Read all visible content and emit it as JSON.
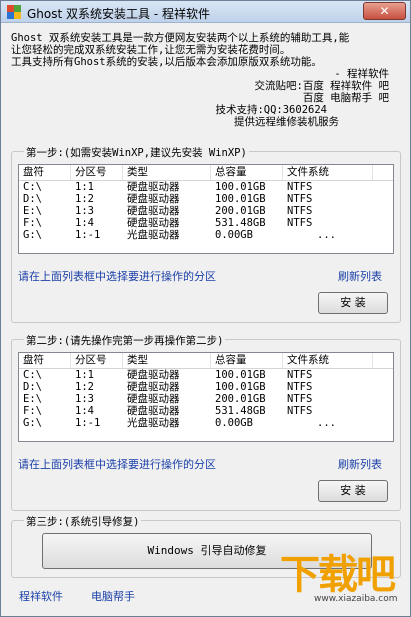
{
  "window": {
    "title": "Ghost 双系统安装工具 - 程祥软件",
    "close_label": "✕"
  },
  "intro": {
    "lines": [
      "Ghost 双系统安装工具是一款方便网友安装两个以上系统的辅助工具,能",
      "让您轻松的完成双系统安装工作,让您无需为安装花费时间。",
      "工具支持所有Ghost系统的安装,以后版本会添加原版双系统功能。"
    ],
    "signature": "- 程祥软件",
    "forum": "交流贴吧:百度 程祥软件 吧",
    "forum2": "百度 电脑帮手 吧",
    "support": "技术支持:QQ:3602624",
    "service": "提供远程维修装机服务"
  },
  "table_headers": [
    "盘符",
    "分区号",
    "类型",
    "总容量",
    "文件系统"
  ],
  "step1": {
    "label": "第一步:(如需安装WinXP,建议先安装 WinXP)",
    "rows": [
      [
        "C:\\",
        "1:1",
        "硬盘驱动器",
        "100.01GB",
        "NTFS"
      ],
      [
        "D:\\",
        "1:2",
        "硬盘驱动器",
        "100.01GB",
        "NTFS"
      ],
      [
        "E:\\",
        "1:3",
        "硬盘驱动器",
        "200.01GB",
        "NTFS"
      ],
      [
        "F:\\",
        "1:4",
        "硬盘驱动器",
        "531.48GB",
        "NTFS"
      ],
      [
        "G:\\",
        "1:-1",
        "光盘驱动器",
        "0.00GB",
        "..."
      ]
    ],
    "hint": "请在上面列表框中选择要进行操作的分区",
    "refresh": "刷新列表",
    "install": "安 装"
  },
  "step2": {
    "label": "第二步:(请先操作完第一步再操作第二步)",
    "rows": [
      [
        "C:\\",
        "1:1",
        "硬盘驱动器",
        "100.01GB",
        "NTFS"
      ],
      [
        "D:\\",
        "1:2",
        "硬盘驱动器",
        "100.01GB",
        "NTFS"
      ],
      [
        "E:\\",
        "1:3",
        "硬盘驱动器",
        "200.01GB",
        "NTFS"
      ],
      [
        "F:\\",
        "1:4",
        "硬盘驱动器",
        "531.48GB",
        "NTFS"
      ],
      [
        "G:\\",
        "1:-1",
        "光盘驱动器",
        "0.00GB",
        "..."
      ]
    ],
    "hint": "请在上面列表框中选择要进行操作的分区",
    "refresh": "刷新列表",
    "install": "安 装"
  },
  "step3": {
    "label": "第三步:(系统引导修复)",
    "repair": "Windows 引导自动修复"
  },
  "footer": {
    "link1": "程祥软件",
    "link2": "电脑帮手"
  },
  "watermark": {
    "text": "下载吧",
    "url": "www.xiazaiba.com"
  },
  "colors": {
    "link": "#1a3fa8",
    "watermark": "#f0a000"
  }
}
